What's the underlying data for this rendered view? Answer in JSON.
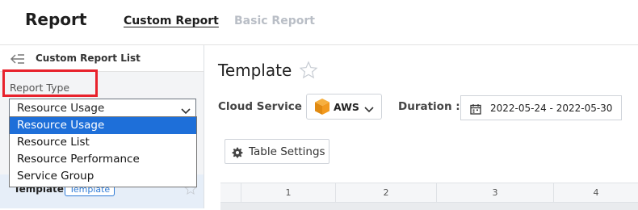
{
  "header": {
    "title": "Report",
    "tabs": [
      {
        "label": "Custom Report",
        "active": true
      },
      {
        "label": "Basic Report",
        "active": false
      }
    ]
  },
  "sidebar": {
    "back_label": "Custom Report List",
    "report_type_label": "Report Type",
    "report_type_value": "Resource Usage",
    "options": [
      "Resource Usage",
      "Resource List",
      "Resource Performance",
      "Service Group"
    ],
    "selected_option": "Resource Usage",
    "template_item": {
      "name": "Template",
      "badge": "Template"
    }
  },
  "main": {
    "title": "Template",
    "cloud_service_label": "Cloud Service :",
    "cloud_service_value": "AWS",
    "duration_label": "Duration :",
    "duration_value": "2022-05-24 - 2022-05-30",
    "table_settings_label": "Table Settings",
    "grid_columns": [
      "1",
      "2",
      "3",
      "4"
    ]
  },
  "colors": {
    "highlight": "#e8222c",
    "selected_option": "#1e6fd9",
    "badge": "#2f7bd6",
    "aws": "#f29a1f"
  },
  "icons": [
    "back-arrow-icon",
    "chevron-down-icon",
    "star-icon",
    "aws-cube-icon",
    "calendar-icon",
    "gear-icon"
  ]
}
